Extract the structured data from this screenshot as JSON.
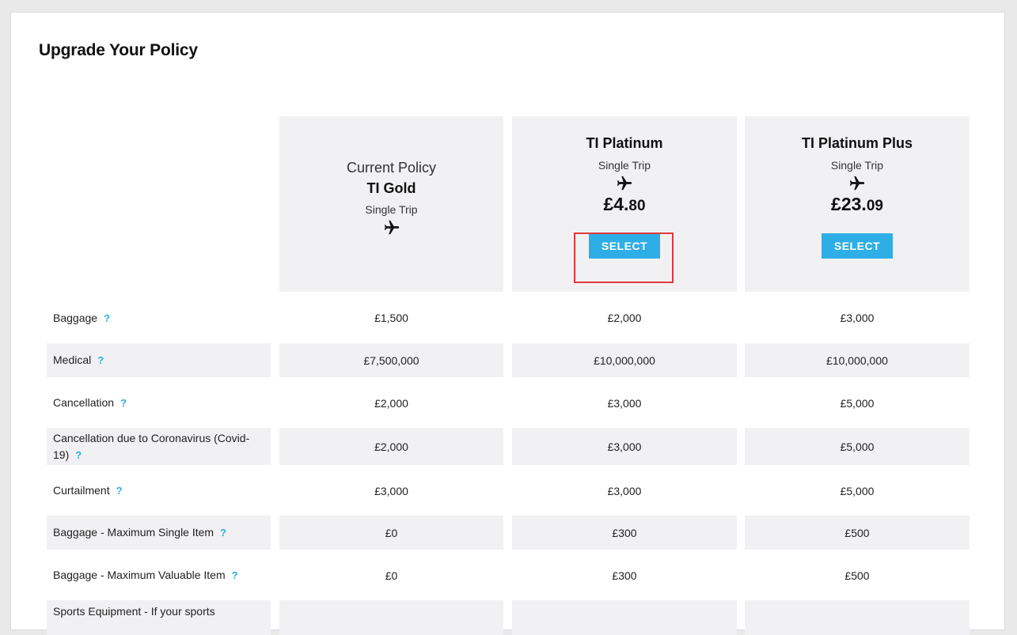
{
  "page_title": "Upgrade Your Policy",
  "plans": [
    {
      "current_label": "Current Policy",
      "name": "TI Gold",
      "trip_type": "Single Trip",
      "icon": "airplane-icon"
    },
    {
      "name": "TI Platinum",
      "trip_type": "Single Trip",
      "icon": "airplane-icon",
      "price_major": "£4.",
      "price_minor": "80",
      "select_label": "SELECT",
      "highlighted": true
    },
    {
      "name": "TI Platinum Plus",
      "trip_type": "Single Trip",
      "icon": "airplane-icon",
      "price_major": "£23.",
      "price_minor": "09",
      "select_label": "SELECT"
    }
  ],
  "help_icon": "?",
  "rows": [
    {
      "label": "Baggage",
      "values": [
        "£1,500",
        "£2,000",
        "£3,000"
      ]
    },
    {
      "label": "Medical",
      "values": [
        "£7,500,000",
        "£10,000,000",
        "£10,000,000"
      ]
    },
    {
      "label": "Cancellation",
      "values": [
        "£2,000",
        "£3,000",
        "£5,000"
      ]
    },
    {
      "label": "Cancellation due to Coronavirus (Covid-19)",
      "values": [
        "£2,000",
        "£3,000",
        "£5,000"
      ]
    },
    {
      "label": "Curtailment",
      "values": [
        "£3,000",
        "£3,000",
        "£5,000"
      ]
    },
    {
      "label": "Baggage - Maximum Single Item",
      "values": [
        "£0",
        "£300",
        "£500"
      ]
    },
    {
      "label": "Baggage - Maximum Valuable Item",
      "values": [
        "£0",
        "£300",
        "£500"
      ]
    },
    {
      "label": "Sports Equipment - If your sports",
      "values": [
        "",
        "",
        ""
      ]
    }
  ],
  "colors": {
    "accent": "#2eaee6",
    "highlight": "#e0393b",
    "shade": "#f1f1f3"
  }
}
